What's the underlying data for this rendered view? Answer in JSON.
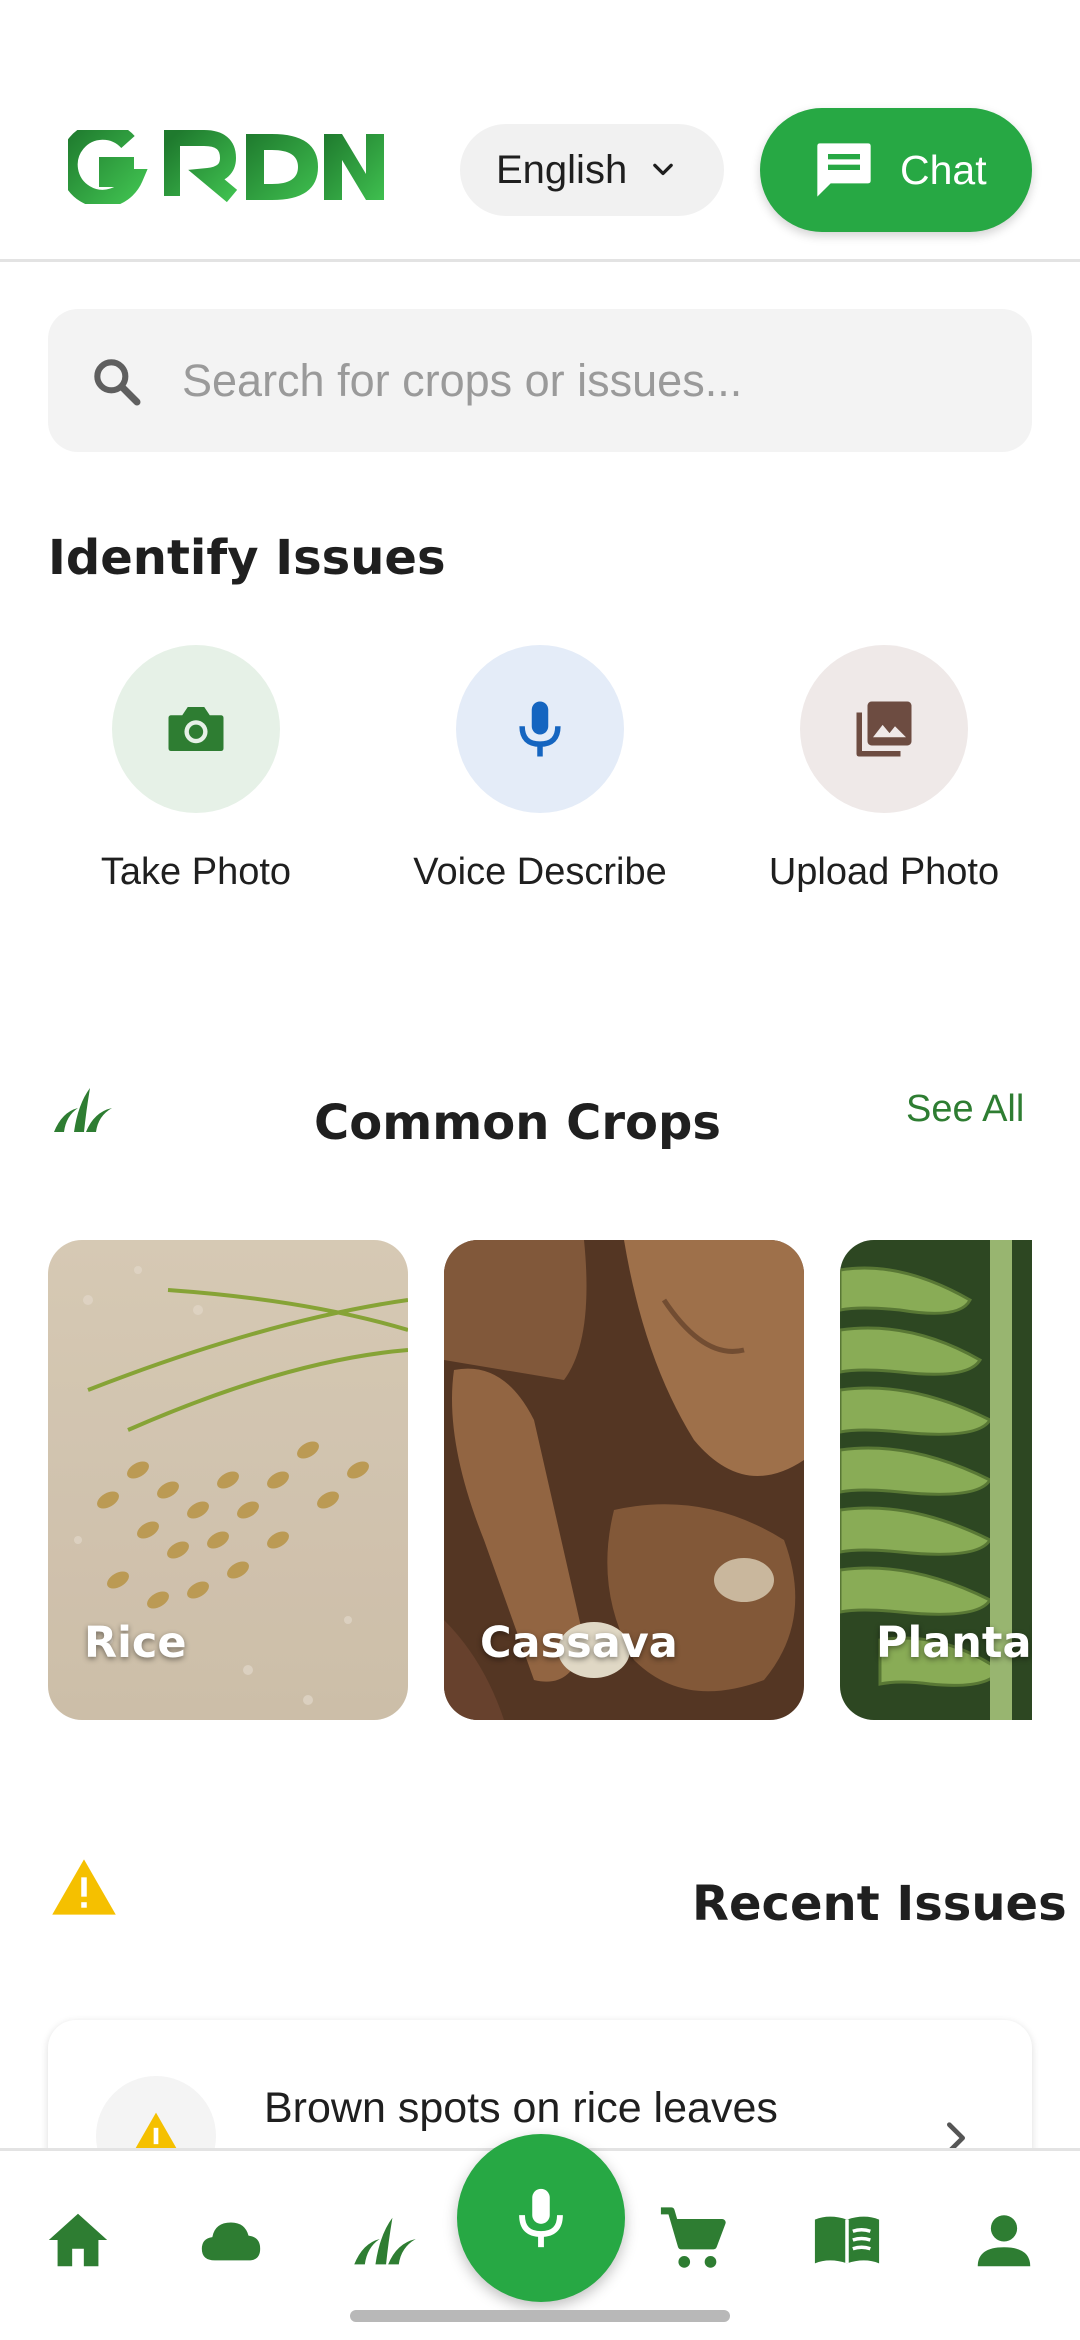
{
  "header": {
    "logo_text": "GRDN",
    "language": "English",
    "chat_label": "Chat"
  },
  "search": {
    "placeholder": "Search for crops or issues..."
  },
  "identify": {
    "title": "Identify Issues",
    "actions": [
      {
        "label": "Take Photo",
        "icon": "camera-icon",
        "bg": "#e6f1e7",
        "color": "#2e7d32"
      },
      {
        "label": "Voice Describe",
        "icon": "microphone-icon",
        "bg": "#e4ecf8",
        "color": "#1565c0"
      },
      {
        "label": "Upload Photo",
        "icon": "photo-library-icon",
        "bg": "#efe9e8",
        "color": "#6d4c41"
      }
    ]
  },
  "crops": {
    "title": "Common Crops",
    "see_all": "See All",
    "items": [
      {
        "name": "Rice"
      },
      {
        "name": "Cassava"
      },
      {
        "name": "Plantain"
      }
    ]
  },
  "recent": {
    "title": "Recent Issues",
    "items": [
      {
        "title": "Brown spots on rice leaves"
      }
    ]
  },
  "bottom_nav": {
    "items": [
      "home-icon",
      "weather-cloud-icon",
      "crops-icon",
      "voice-mic-icon",
      "cart-icon",
      "library-book-icon",
      "profile-icon"
    ]
  },
  "colors": {
    "brand_green": "#27a844",
    "dark_green": "#2e7d32",
    "warning": "#f5c000"
  }
}
